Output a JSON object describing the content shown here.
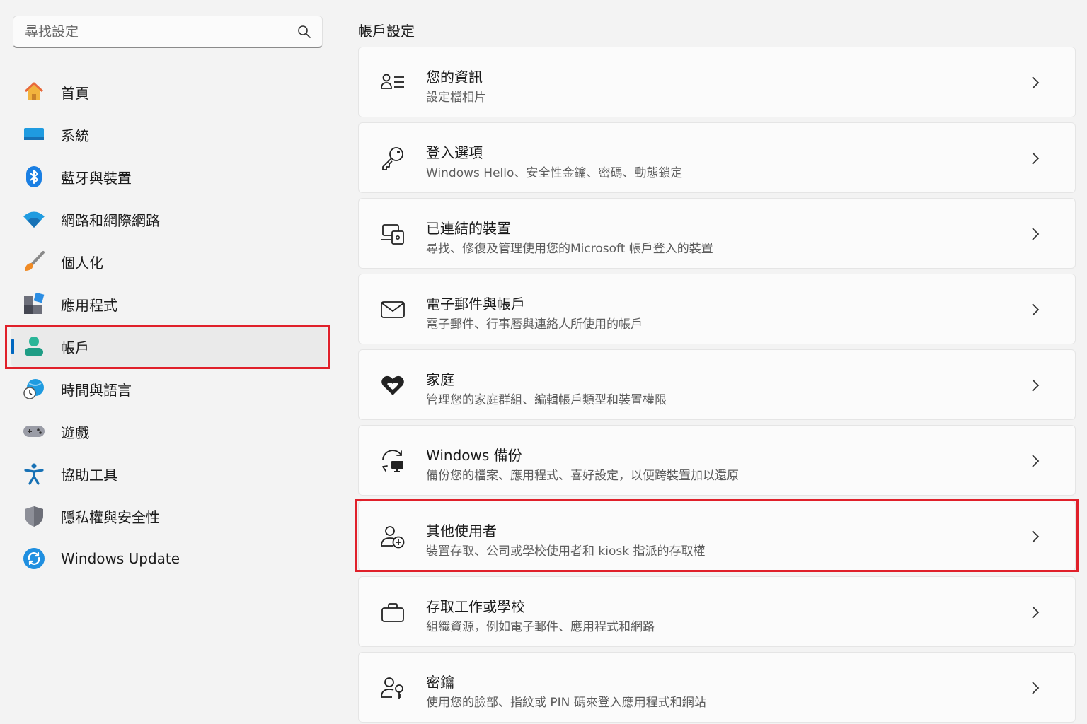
{
  "search": {
    "placeholder": "尋找設定"
  },
  "sidebar": {
    "items": [
      {
        "label": "首頁",
        "icon": "home-icon"
      },
      {
        "label": "系統",
        "icon": "system-icon"
      },
      {
        "label": "藍牙與裝置",
        "icon": "bluetooth-icon"
      },
      {
        "label": "網路和網際網路",
        "icon": "wifi-icon"
      },
      {
        "label": "個人化",
        "icon": "brush-icon"
      },
      {
        "label": "應用程式",
        "icon": "apps-icon"
      },
      {
        "label": "帳戶",
        "icon": "account-icon",
        "active": true
      },
      {
        "label": "時間與語言",
        "icon": "time-language-icon"
      },
      {
        "label": "遊戲",
        "icon": "gamepad-icon"
      },
      {
        "label": "協助工具",
        "icon": "accessibility-icon"
      },
      {
        "label": "隱私權與安全性",
        "icon": "shield-icon"
      },
      {
        "label": "Windows Update",
        "icon": "windows-update-icon"
      }
    ]
  },
  "main": {
    "title": "帳戶設定",
    "cards": [
      {
        "title": "您的資訊",
        "subtitle": "設定檔相片",
        "icon": "user-info-icon"
      },
      {
        "title": "登入選項",
        "subtitle": "Windows Hello、安全性金鑰、密碼、動態鎖定",
        "icon": "key-icon"
      },
      {
        "title": "已連結的裝置",
        "subtitle": "尋找、修復及管理使用您的Microsoft 帳戶登入的裝置",
        "icon": "linked-devices-icon"
      },
      {
        "title": "電子郵件與帳戶",
        "subtitle": "電子郵件、行事曆與連絡人所使用的帳戶",
        "icon": "mail-icon"
      },
      {
        "title": "家庭",
        "subtitle": "管理您的家庭群組、編輯帳戶類型和裝置權限",
        "icon": "family-heart-icon"
      },
      {
        "title": "Windows 備份",
        "subtitle": "備份您的檔案、應用程式、喜好設定，以便跨裝置加以還原",
        "icon": "backup-icon"
      },
      {
        "title": "其他使用者",
        "subtitle": "裝置存取、公司或學校使用者和 kiosk 指派的存取權",
        "icon": "add-user-icon"
      },
      {
        "title": "存取工作或學校",
        "subtitle": "組織資源，例如電子郵件、應用程式和網路",
        "icon": "briefcase-icon"
      },
      {
        "title": "密鑰",
        "subtitle": "使用您的臉部、指紋或 PIN 碼來登入應用程式和網站",
        "icon": "passkey-icon"
      }
    ]
  },
  "colors": {
    "accent": "#0067c0",
    "highlight": "#e0202a"
  }
}
